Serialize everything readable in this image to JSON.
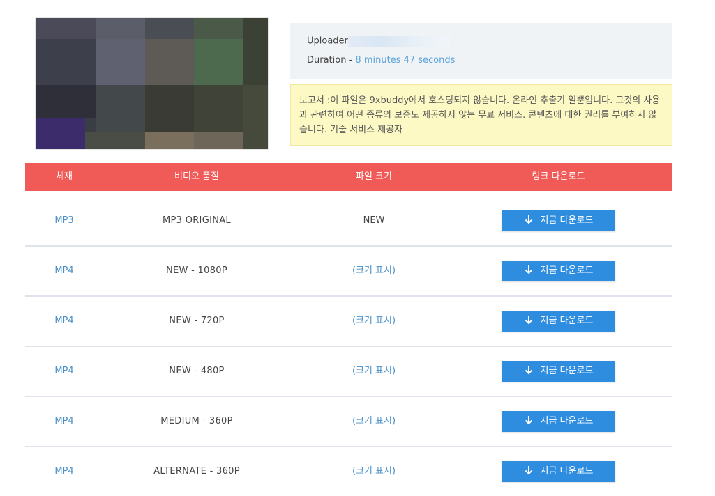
{
  "thumbnail": {
    "colors": [
      "#4a4a58",
      "#5b5e69",
      "#5e5a56",
      "#4b5a48",
      "#3c4136",
      "#43443f",
      "#3a3b34",
      "#2f2f2a",
      "#464a3c",
      "#6e6658",
      "#2a2235",
      "#7a6e5c",
      "#3d2c6b"
    ]
  },
  "meta": {
    "uploader_label": "Uploader",
    "duration_label": "Duration - ",
    "duration_value": "8 minutes 47 seconds"
  },
  "notice": {
    "text": "보고서 :이 파일은 9xbuddy에서 호스팅되지 않습니다. 온라인 추출기 일뿐입니다. 그것의 사용과 관련하여 어떤 종류의 보증도 제공하지 않는 무료 서비스. 콘텐츠에 대한 권리를 부여하지 않습니다. 기술 서비스 제공자"
  },
  "table": {
    "headers": [
      "체재",
      "비디오 품질",
      "파일 크기",
      "링크 다운로드"
    ],
    "button_label": "지금 다운로드",
    "rows": [
      {
        "format": "MP3",
        "quality": "MP3 ORIGINAL",
        "size": "NEW"
      },
      {
        "format": "MP4",
        "quality": "NEW - 1080P",
        "size": "(크기 표시)"
      },
      {
        "format": "MP4",
        "quality": "NEW - 720P",
        "size": "(크기 표시)"
      },
      {
        "format": "MP4",
        "quality": "NEW - 480P",
        "size": "(크기 표시)"
      },
      {
        "format": "MP4",
        "quality": "MEDIUM - 360P",
        "size": "(크기 표시)"
      },
      {
        "format": "MP4",
        "quality": "ALTERNATE - 360P",
        "size": "(크기 표시)"
      }
    ]
  },
  "colors": {
    "header_bg": "#f05a57",
    "button_bg": "#2f8de0",
    "link": "#4a90c8",
    "notice_bg": "#fdf9c4",
    "meta_bg": "#eff3f6"
  }
}
